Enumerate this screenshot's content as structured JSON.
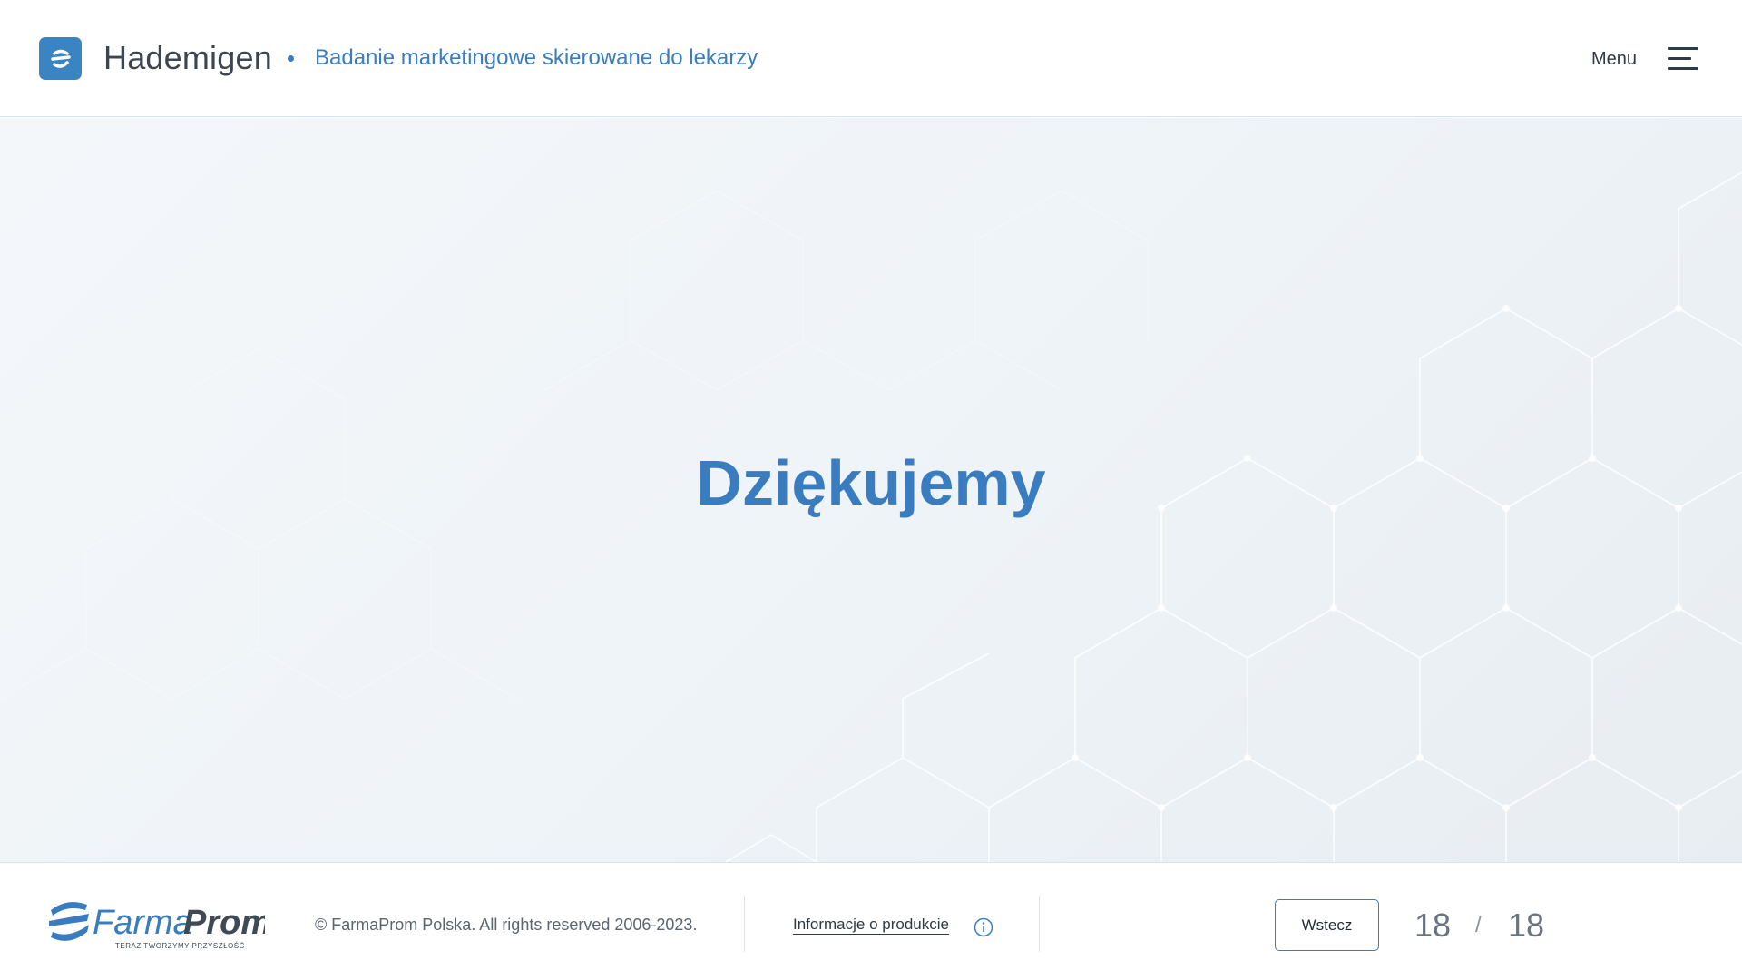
{
  "header": {
    "app_title": "Hademigen",
    "subtitle": "Badanie marketingowe skierowane do lekarzy",
    "menu_label": "Menu",
    "logo_icon": "hademigen-logo-icon",
    "menu_icon": "hamburger-menu-icon"
  },
  "main": {
    "heading": "Dziękujemy"
  },
  "footer": {
    "logo_text_farma": "Farma",
    "logo_text_prom": "Prom",
    "logo_tagline": "TERAZ TWORZYMY PRZYSZŁOŚĆ",
    "copyright": "© FarmaProm Polska. All rights reserved 2006-2023.",
    "info_link": "Informacje o produkcie",
    "info_icon": "info-circle-icon",
    "back_button": "Wstecz",
    "page_current": "18",
    "page_separator": "/",
    "page_total": "18"
  },
  "colors": {
    "accent": "#3a7cc0",
    "logo_badge": "#3a84c4",
    "text_dark": "#3b4652",
    "background": "#eef3f7"
  }
}
